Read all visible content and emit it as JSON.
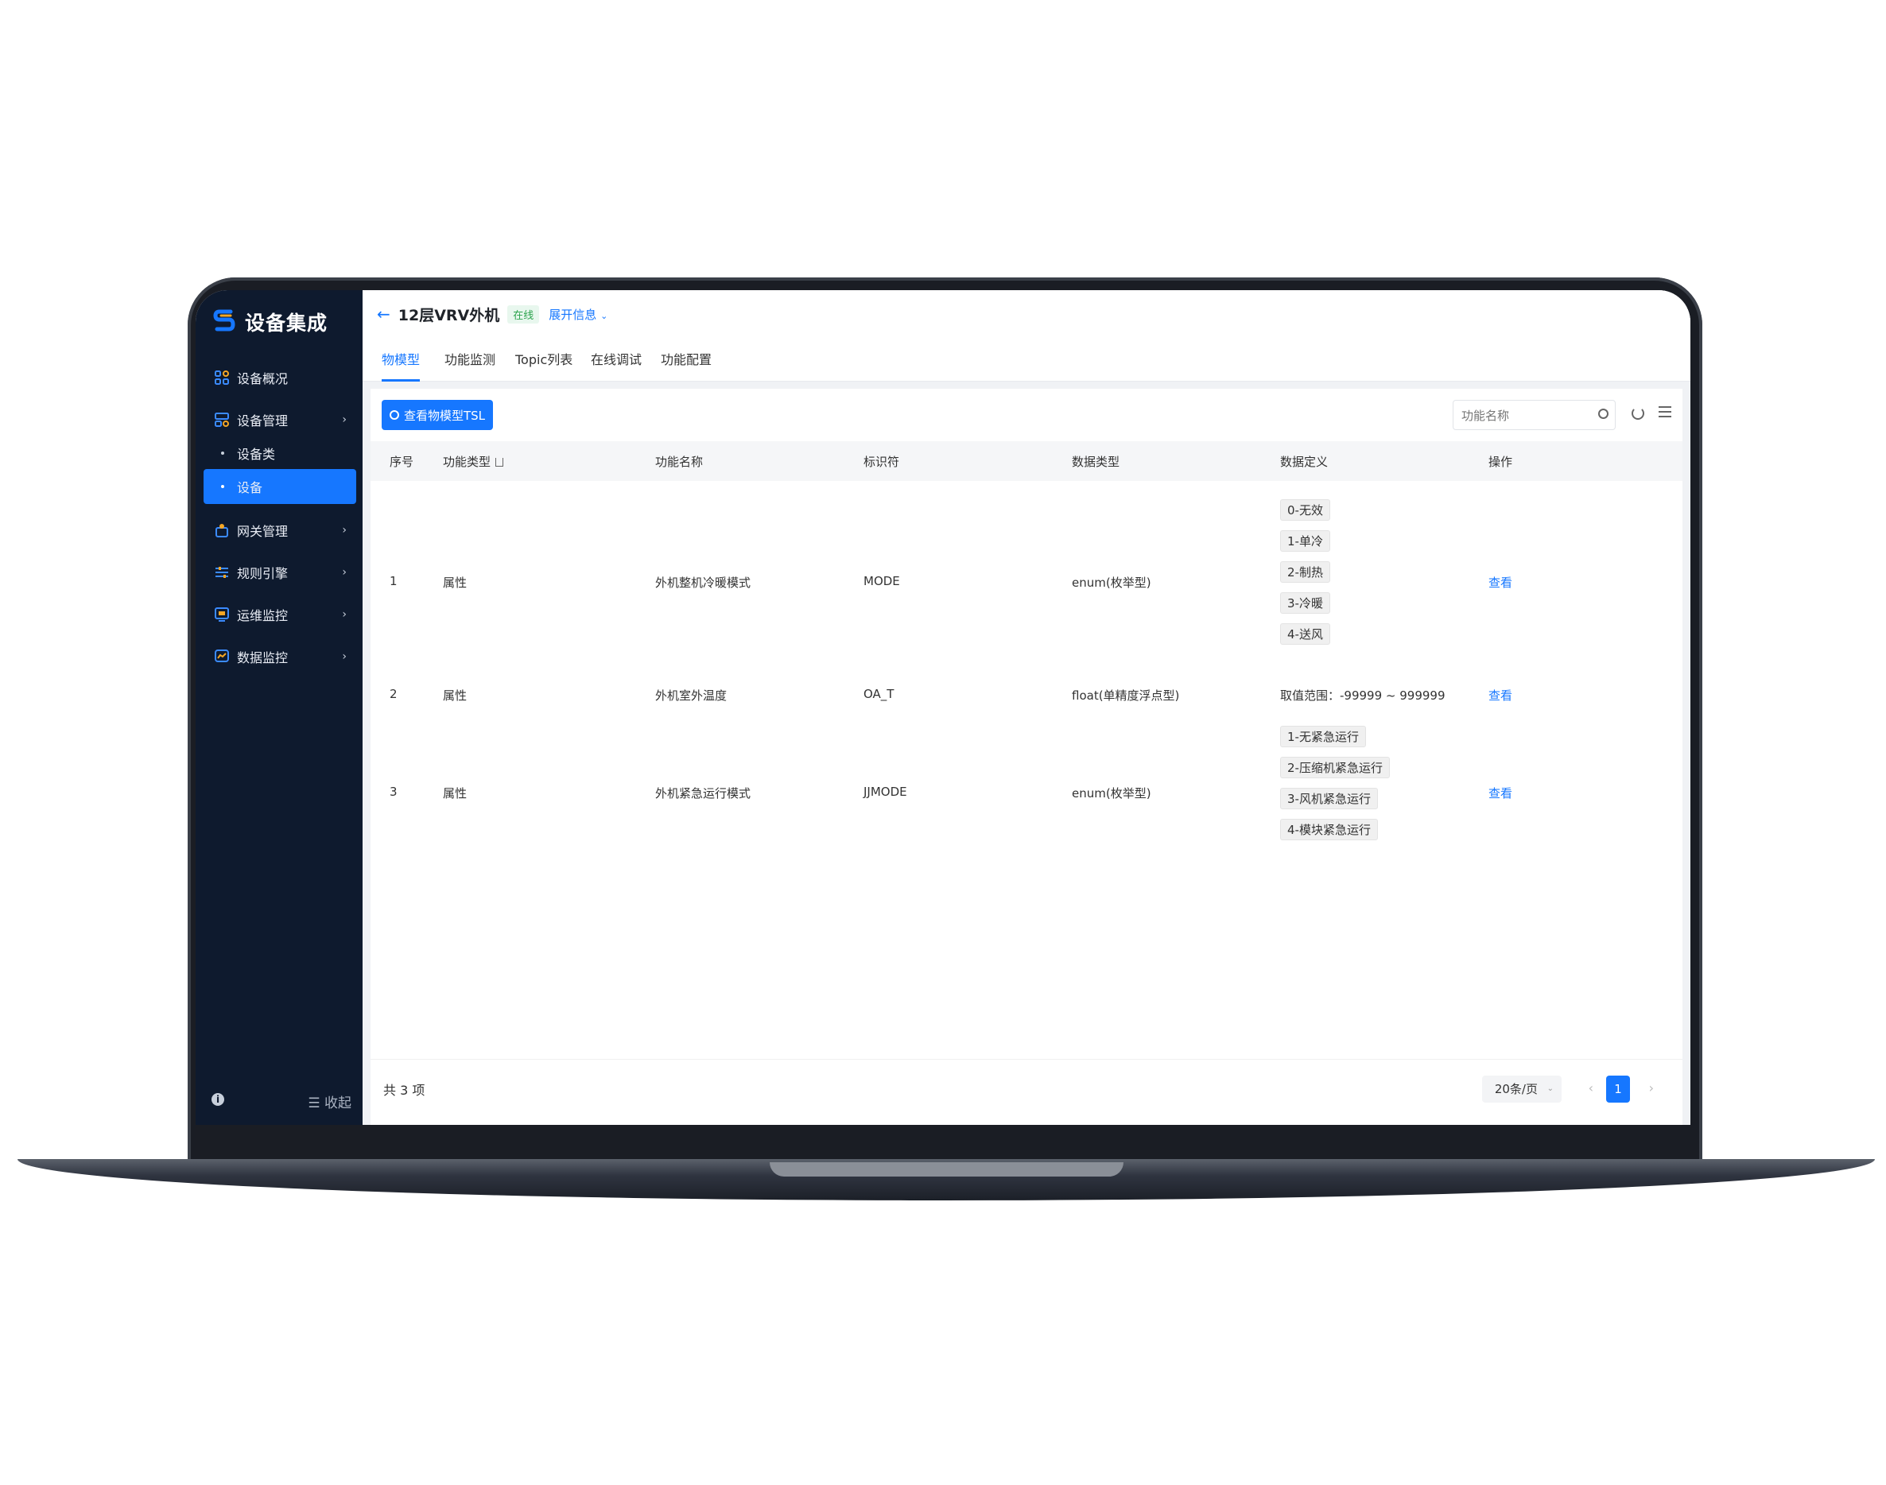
{
  "brand": {
    "title": "设备集成"
  },
  "sidebar": {
    "items": [
      {
        "label": "设备概况",
        "icon": "overview-icon"
      },
      {
        "label": "设备管理",
        "icon": "device-manage-icon"
      },
      {
        "label": "网关管理",
        "icon": "gateway-icon"
      },
      {
        "label": "规则引擎",
        "icon": "rules-icon"
      },
      {
        "label": "运维监控",
        "icon": "ops-monitor-icon"
      },
      {
        "label": "数据监控",
        "icon": "data-monitor-icon"
      }
    ],
    "subitems": [
      {
        "label": "设备类"
      },
      {
        "label": "设备"
      }
    ],
    "collapse_label": "收起"
  },
  "header": {
    "title": "12层VRV外机",
    "status": "在线",
    "expand_label": "展开信息"
  },
  "tabs": [
    {
      "label": "物模型"
    },
    {
      "label": "功能监测"
    },
    {
      "label": "Topic列表"
    },
    {
      "label": "在线调试"
    },
    {
      "label": "功能配置"
    }
  ],
  "toolbar": {
    "view_tsl_label": "查看物模型TSL",
    "search_placeholder": "功能名称"
  },
  "table": {
    "columns": [
      "序号",
      "功能类型",
      "功能名称",
      "标识符",
      "数据类型",
      "数据定义",
      "操作"
    ],
    "rows": [
      {
        "index": "1",
        "type": "属性",
        "name": "外机整机冷暖模式",
        "identifier": "MODE",
        "data_type": "enum(枚举型)",
        "definitions": [
          "0-无效",
          "1-单冷",
          "2-制热",
          "3-冷暖",
          "4-送风"
        ],
        "action": "查看"
      },
      {
        "index": "2",
        "type": "属性",
        "name": "外机室外温度",
        "identifier": "OA_T",
        "data_type": "float(单精度浮点型)",
        "range_text": "取值范围：-99999 ~ 999999",
        "action": "查看"
      },
      {
        "index": "3",
        "type": "属性",
        "name": "外机紧急运行模式",
        "identifier": "JJMODE",
        "data_type": "enum(枚举型)",
        "definitions": [
          "1-无紧急运行",
          "2-压缩机紧急运行",
          "3-风机紧急运行",
          "4-模块紧急运行"
        ],
        "action": "查看"
      }
    ]
  },
  "pagination": {
    "total_text": "共 3 项",
    "page_size": "20条/页",
    "current_page": "1"
  },
  "colors": {
    "accent": "#1677ff",
    "sidebar_bg": "#0e1a2e",
    "online": "#2ea44f"
  }
}
